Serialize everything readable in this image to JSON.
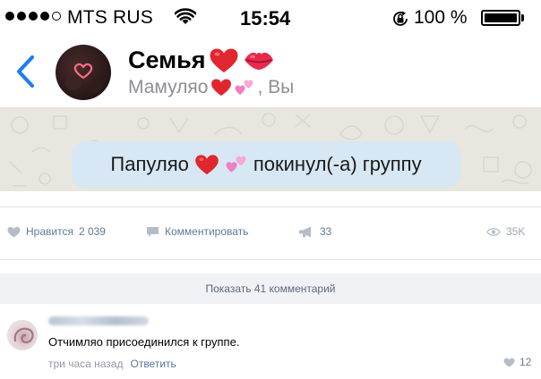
{
  "status_bar": {
    "carrier": "MTS RUS",
    "time": "15:54",
    "battery_percent": "100 %"
  },
  "chat": {
    "title": "Семья",
    "members_prefix": "Мамуляо",
    "members_suffix": ", Вы",
    "system_prefix": "Папуляо",
    "system_suffix": "покинул(-а) группу"
  },
  "post": {
    "like_label": "Нравится",
    "like_count": "2 039",
    "comment_label": "Комментировать",
    "share_count": "33",
    "views_count": "35K",
    "show_comments": "Показать 41 комментарий"
  },
  "comment": {
    "text": "Отчимляо присоединился к группе.",
    "time": "три часа назад",
    "reply_label": "Ответить",
    "like_count": "12"
  },
  "colors": {
    "ios_blue": "#1f7cf0",
    "heart_red": "#e0262f",
    "bubble": "#d7e7f3",
    "chat_bg": "#e8e6df",
    "vk_gray": "#6d7885"
  }
}
